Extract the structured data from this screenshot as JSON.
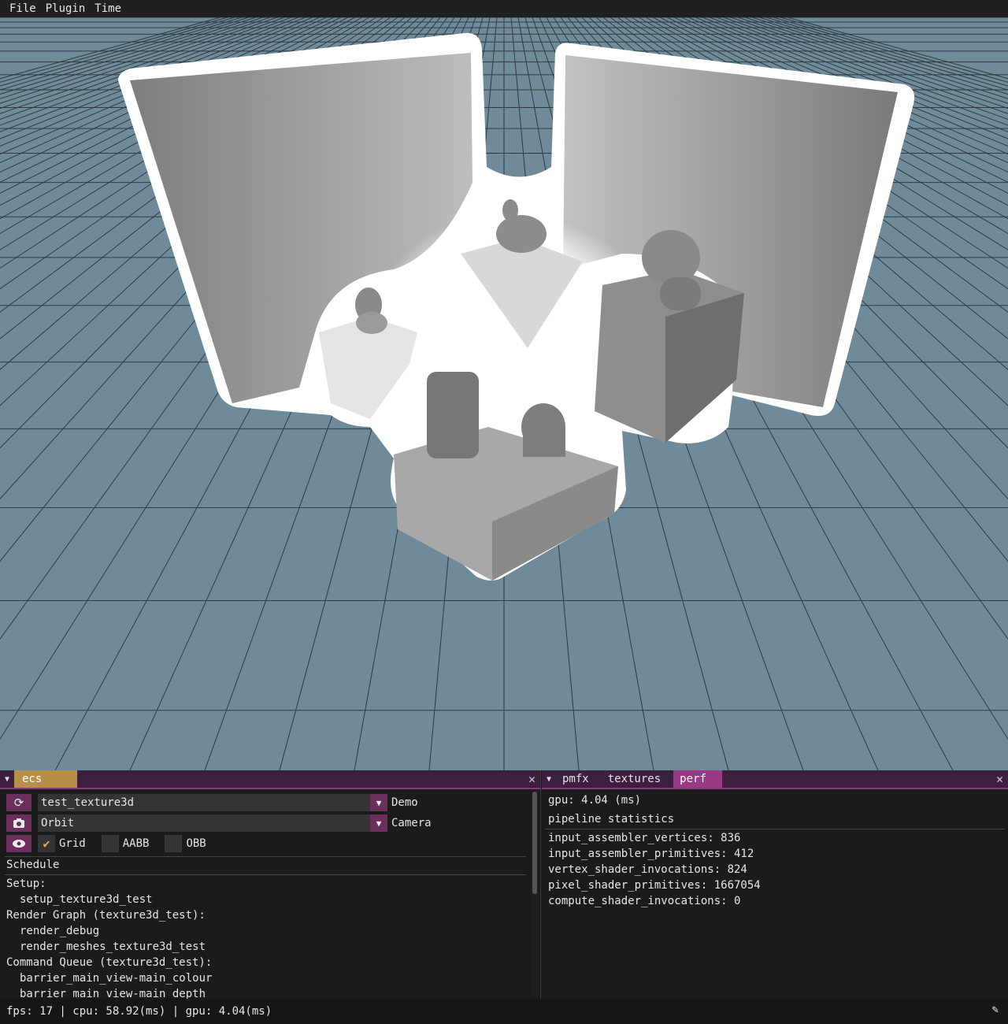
{
  "menubar": {
    "items": [
      "File",
      "Plugin",
      "Time"
    ]
  },
  "colors": {
    "viewport_bg": "#6f8b99",
    "panel_header": "#3d2040",
    "accent": "#9a3a84",
    "ecs_tab": "#b88f47"
  },
  "ecs_panel": {
    "tab": "ecs",
    "demo_combo": {
      "value": "test_texture3d",
      "label": "Demo",
      "icon": "refresh-icon"
    },
    "camera_combo": {
      "value": "Orbit",
      "label": "Camera",
      "icon": "camera-icon"
    },
    "view_toggles": {
      "icon": "eye-icon",
      "grid": {
        "label": "Grid",
        "checked": true
      },
      "aabb": {
        "label": "AABB",
        "checked": false
      },
      "obb": {
        "label": "OBB",
        "checked": false
      }
    },
    "schedule_header": "Schedule",
    "schedule_lines": [
      {
        "text": "Setup:",
        "indent": false
      },
      {
        "text": "setup_texture3d_test",
        "indent": true
      },
      {
        "text": "Render Graph (texture3d_test):",
        "indent": false
      },
      {
        "text": "render_debug",
        "indent": true
      },
      {
        "text": "render_meshes_texture3d_test",
        "indent": true
      },
      {
        "text": "Command Queue (texture3d_test):",
        "indent": false
      },
      {
        "text": "barrier_main_view-main_colour",
        "indent": true
      },
      {
        "text": "barrier_main_view-main_depth",
        "indent": true
      }
    ]
  },
  "perf_panel": {
    "tabs": [
      "pmfx",
      "textures",
      "perf"
    ],
    "active_tab": "perf",
    "gpu": "gpu: 4.04 (ms)",
    "pipeline_header": "pipeline statistics",
    "stats": [
      "input_assembler_vertices: 836",
      "input_assembler_primitives: 412",
      "vertex_shader_invocations: 824",
      "pixel_shader_primitives: 1667054",
      "compute_shader_invocations: 0"
    ]
  },
  "statusbar": {
    "text": "fps: 17 | cpu: 58.92(ms) | gpu: 4.04(ms)",
    "icon": "pen-icon"
  }
}
